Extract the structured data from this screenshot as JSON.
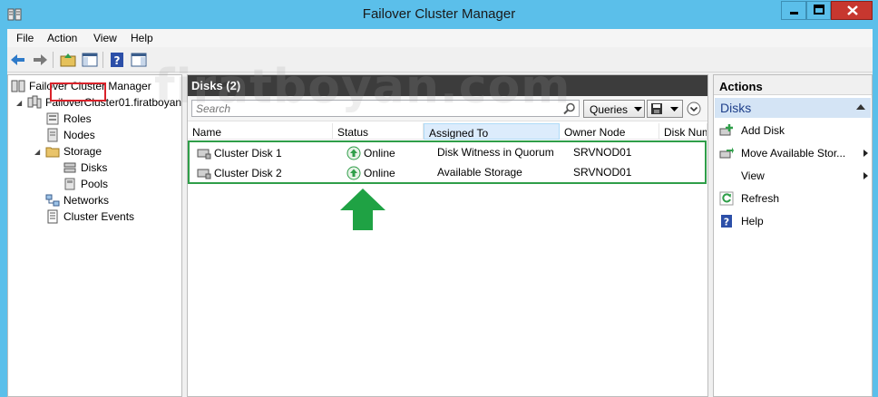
{
  "window": {
    "title": "Failover Cluster Manager",
    "app_icon": "cluster-icon",
    "controls": [
      "minimize",
      "maximize",
      "close"
    ]
  },
  "menu": {
    "items": [
      "File",
      "Action",
      "View",
      "Help"
    ]
  },
  "toolbar": {
    "buttons": [
      "back-icon",
      "forward-icon",
      "up-folder-icon",
      "show-hide-tree-icon",
      "help-icon",
      "show-hide-action-icon"
    ]
  },
  "tree": {
    "root": "Failover Cluster Manager",
    "cluster": "FailoverCluster01.firatboyan",
    "items": [
      "Roles",
      "Nodes",
      "Storage",
      "Disks",
      "Pools",
      "Networks",
      "Cluster Events"
    ]
  },
  "center": {
    "header": "Disks (2)",
    "search_placeholder": "Search",
    "queries_label": "Queries",
    "columns": [
      "Name",
      "Status",
      "Assigned To",
      "Owner Node",
      "Disk Numb"
    ],
    "rows": [
      {
        "name": "Cluster Disk 1",
        "status": "Online",
        "assigned": "Disk Witness in Quorum",
        "owner": "SRVNOD01"
      },
      {
        "name": "Cluster Disk 2",
        "status": "Online",
        "assigned": "Available Storage",
        "owner": "SRVNOD01"
      }
    ]
  },
  "actions": {
    "title": "Actions",
    "section": "Disks",
    "items": [
      "Add Disk",
      "Move Available Stor...",
      "View",
      "Refresh",
      "Help"
    ]
  },
  "watermark": "firatboyan.com",
  "colors": {
    "titlebar": "#5bbfea",
    "close": "#c7372f",
    "header": "#3c3c3c",
    "highlight_red": "#d9222a",
    "highlight_green": "#2f9e49"
  }
}
